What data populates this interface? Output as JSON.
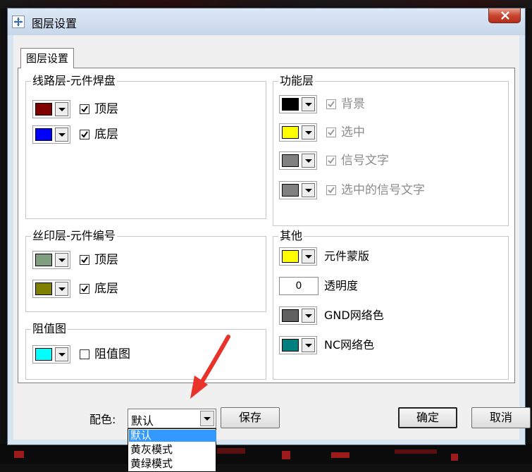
{
  "window": {
    "title": "图层设置",
    "close_glyph": "X"
  },
  "tab": {
    "label": "图层设置"
  },
  "groups": {
    "circuit": {
      "title": "线路层-元件焊盘",
      "items": [
        {
          "label": "顶层",
          "color": "#800000",
          "checked": true
        },
        {
          "label": "底层",
          "color": "#0000ff",
          "checked": true
        }
      ]
    },
    "silk": {
      "title": "丝印层-元件编号",
      "items": [
        {
          "label": "顶层",
          "color": "#7f9f7f",
          "checked": true
        },
        {
          "label": "底层",
          "color": "#808000",
          "checked": true
        }
      ]
    },
    "resistance": {
      "title": "阻值图",
      "items": [
        {
          "label": "阻值图",
          "color": "#00ffff",
          "checked": false
        }
      ]
    },
    "function": {
      "title": "功能层",
      "items": [
        {
          "label": "背景",
          "color": "#000000",
          "checked": true
        },
        {
          "label": "选中",
          "color": "#ffff00",
          "checked": true
        },
        {
          "label": "信号文字",
          "color": "#808080",
          "checked": true
        },
        {
          "label": "选中的信号文字",
          "color": "#808080",
          "checked": true
        }
      ]
    },
    "other": {
      "title": "其他",
      "mask_label": "元件蒙版",
      "mask_color": "#ffff00",
      "opacity_label": "透明度",
      "opacity_value": "0",
      "gnd_label": "GND网络色",
      "gnd_color": "#606060",
      "nc_label": "NC网络色",
      "nc_color": "#007f7f"
    }
  },
  "footer": {
    "scheme_label": "配色:",
    "scheme_value": "默认",
    "scheme_options": [
      "默认",
      "黄灰模式",
      "黄绿模式"
    ],
    "save_label": "保存",
    "ok_label": "确定",
    "cancel_label": "取消"
  },
  "colors": {
    "annotation_arrow": "#e8322a",
    "selection": "#3399ff"
  }
}
